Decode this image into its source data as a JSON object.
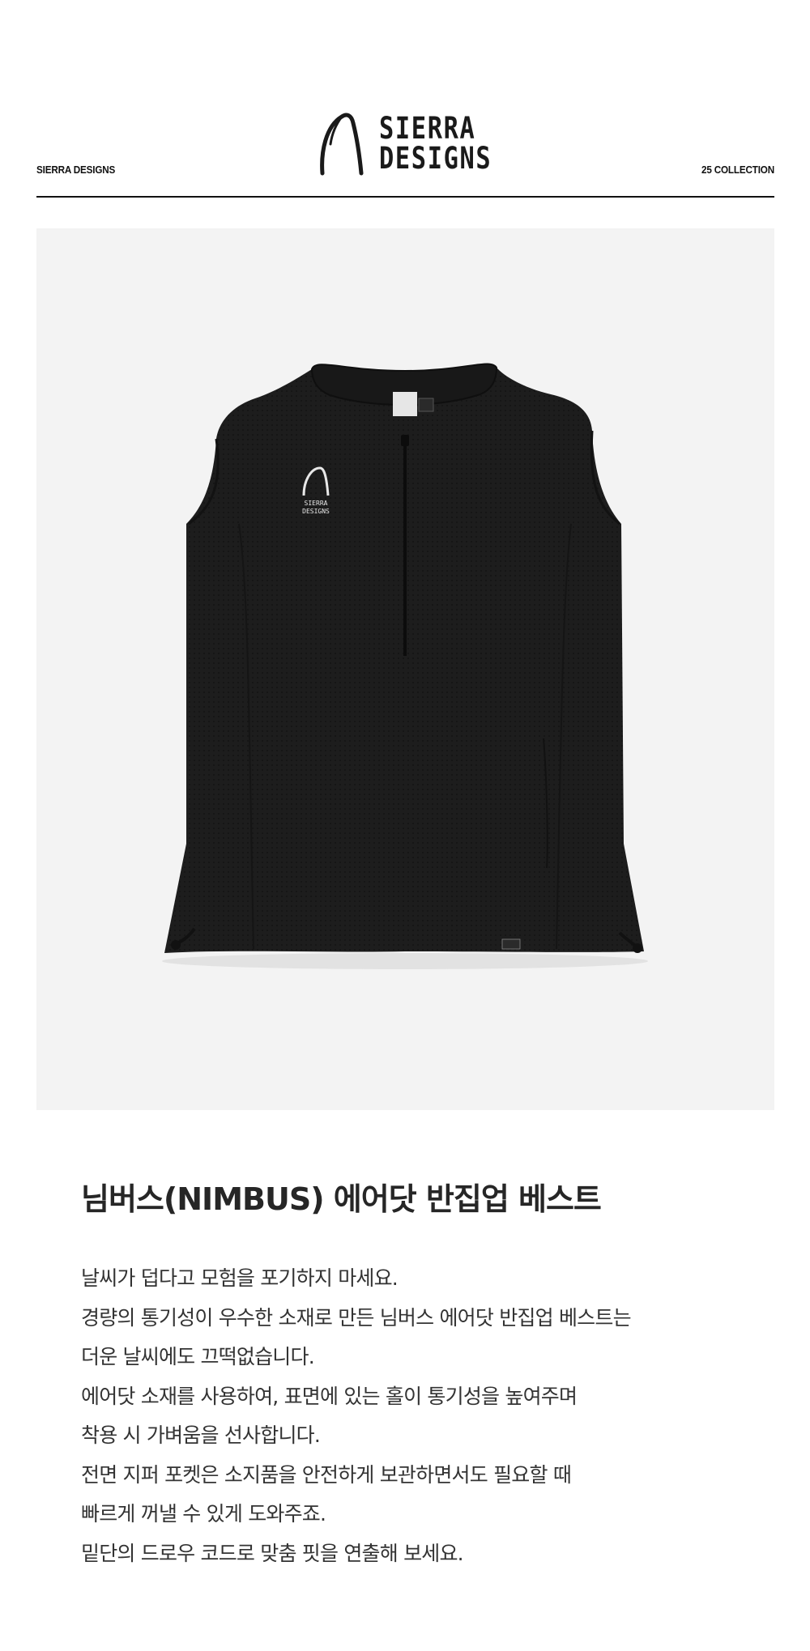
{
  "header": {
    "left_label": "SIERRA DESIGNS",
    "right_label": "25 COLLECTION",
    "logo": {
      "line1": "SIERRA",
      "line2": "DESIGNS"
    }
  },
  "hero": {
    "background": "#f3f3f3",
    "product_color": "#1c1c1c",
    "chest_logo": {
      "line1": "SIERRA",
      "line2": "DESIGNS"
    },
    "label_text": "SIERRA DESIGNS"
  },
  "product": {
    "title": "님버스(NIMBUS) 에어닷 반집업 베스트",
    "description": [
      "날씨가 덥다고 모험을 포기하지 마세요.",
      "경량의 통기성이 우수한 소재로 만든 님버스 에어닷 반집업 베스트는",
      "더운 날씨에도 끄떡없습니다.",
      "에어닷 소재를 사용하여, 표면에 있는 홀이 통기성을 높여주며",
      "착용 시 가벼움을 선사합니다.",
      "전면 지퍼 포켓은 소지품을 안전하게 보관하면서도 필요할 때",
      "빠르게 꺼낼 수 있게 도와주죠.",
      "밑단의 드로우 코드로 맞춤 핏을 연출해 보세요."
    ]
  }
}
